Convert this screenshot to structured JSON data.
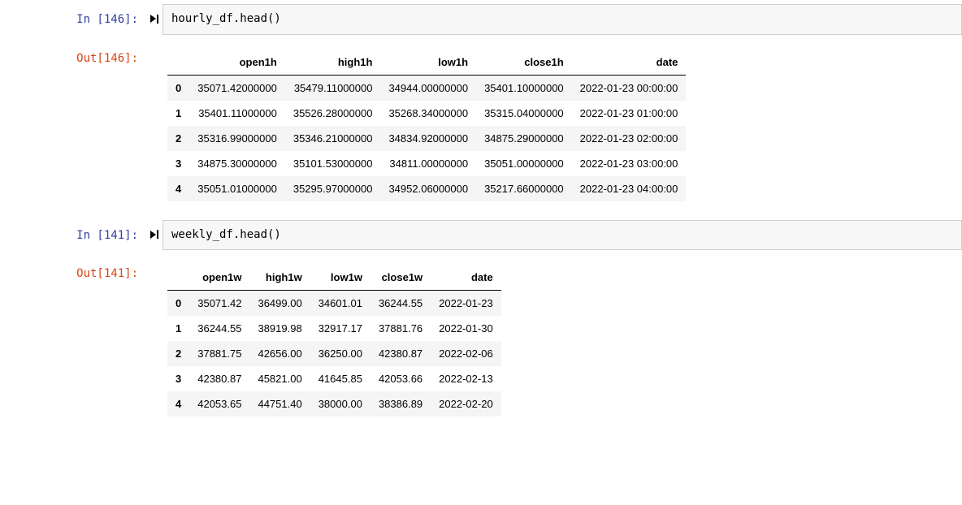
{
  "cells": [
    {
      "in_prompt": "In [146]:",
      "out_prompt": "Out[146]:",
      "code": "hourly_df.head()",
      "table": {
        "headers": [
          "open1h",
          "high1h",
          "low1h",
          "close1h",
          "date"
        ],
        "rows": [
          {
            "idx": "0",
            "cells": [
              "35071.42000000",
              "35479.11000000",
              "34944.00000000",
              "35401.10000000",
              "2022-01-23 00:00:00"
            ]
          },
          {
            "idx": "1",
            "cells": [
              "35401.11000000",
              "35526.28000000",
              "35268.34000000",
              "35315.04000000",
              "2022-01-23 01:00:00"
            ]
          },
          {
            "idx": "2",
            "cells": [
              "35316.99000000",
              "35346.21000000",
              "34834.92000000",
              "34875.29000000",
              "2022-01-23 02:00:00"
            ]
          },
          {
            "idx": "3",
            "cells": [
              "34875.30000000",
              "35101.53000000",
              "34811.00000000",
              "35051.00000000",
              "2022-01-23 03:00:00"
            ]
          },
          {
            "idx": "4",
            "cells": [
              "35051.01000000",
              "35295.97000000",
              "34952.06000000",
              "35217.66000000",
              "2022-01-23 04:00:00"
            ]
          }
        ]
      }
    },
    {
      "in_prompt": "In [141]:",
      "out_prompt": "Out[141]:",
      "code": "weekly_df.head()",
      "table": {
        "headers": [
          "open1w",
          "high1w",
          "low1w",
          "close1w",
          "date"
        ],
        "rows": [
          {
            "idx": "0",
            "cells": [
              "35071.42",
              "36499.00",
              "34601.01",
              "36244.55",
              "2022-01-23"
            ]
          },
          {
            "idx": "1",
            "cells": [
              "36244.55",
              "38919.98",
              "32917.17",
              "37881.76",
              "2022-01-30"
            ]
          },
          {
            "idx": "2",
            "cells": [
              "37881.75",
              "42656.00",
              "36250.00",
              "42380.87",
              "2022-02-06"
            ]
          },
          {
            "idx": "3",
            "cells": [
              "42380.87",
              "45821.00",
              "41645.85",
              "42053.66",
              "2022-02-13"
            ]
          },
          {
            "idx": "4",
            "cells": [
              "42053.65",
              "44751.40",
              "38000.00",
              "38386.89",
              "2022-02-20"
            ]
          }
        ]
      }
    }
  ]
}
